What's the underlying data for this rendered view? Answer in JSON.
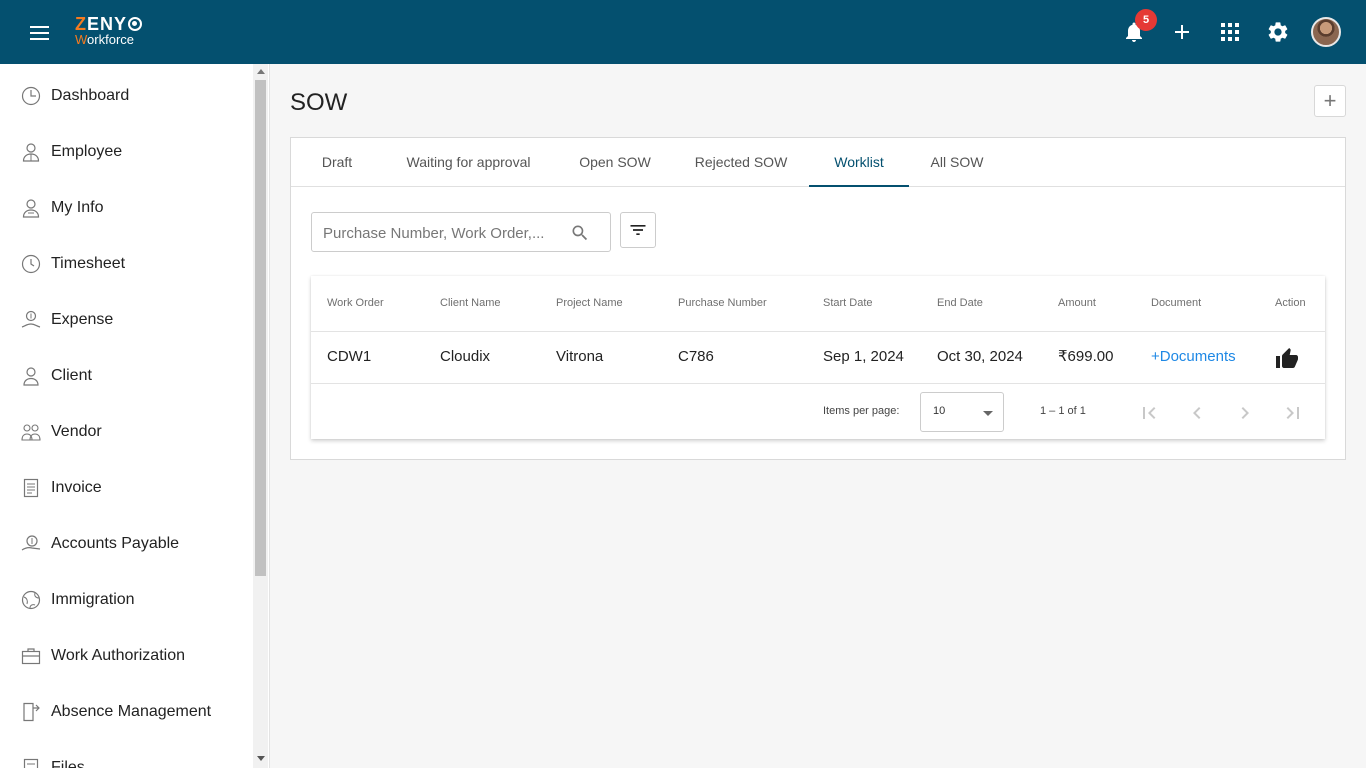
{
  "header": {
    "logo_top": "ZENY",
    "logo_bottom": "Workforce",
    "notification_count": "5",
    "brand_color": "#04506f",
    "accent_color": "#f47b20",
    "icons": [
      "menu-icon",
      "bell-icon",
      "plus-icon",
      "apps-grid-icon",
      "gear-icon",
      "avatar"
    ]
  },
  "sidebar": {
    "items": [
      {
        "label": "Dashboard",
        "icon": "dashboard-icon"
      },
      {
        "label": "Employee",
        "icon": "employee-icon"
      },
      {
        "label": "My Info",
        "icon": "my-info-icon"
      },
      {
        "label": "Timesheet",
        "icon": "clock-icon"
      },
      {
        "label": "Expense",
        "icon": "expense-icon"
      },
      {
        "label": "Client",
        "icon": "client-icon"
      },
      {
        "label": "Vendor",
        "icon": "vendor-icon"
      },
      {
        "label": "Invoice",
        "icon": "invoice-icon"
      },
      {
        "label": "Accounts Payable",
        "icon": "accounts-payable-icon"
      },
      {
        "label": "Immigration",
        "icon": "globe-icon"
      },
      {
        "label": "Work Authorization",
        "icon": "briefcase-icon"
      },
      {
        "label": "Absence Management",
        "icon": "door-icon"
      },
      {
        "label": "Files",
        "icon": "files-icon"
      }
    ]
  },
  "main": {
    "title": "SOW",
    "tabs": [
      "Draft",
      "Waiting for approval",
      "Open SOW",
      "Rejected SOW",
      "Worklist",
      "All SOW"
    ],
    "active_tab": "Worklist",
    "search": {
      "placeholder": "Purchase Number, Work Order,..."
    },
    "table": {
      "columns": [
        "Work Order",
        "Client Name",
        "Project Name",
        "Purchase Number",
        "Start Date",
        "End Date",
        "Amount",
        "Document",
        "Action"
      ],
      "rows": [
        {
          "work_order": "CDW1",
          "client_name": "Cloudix",
          "project_name": "Vitrona",
          "purchase_number": "C786",
          "start_date": "Sep 1, 2024",
          "end_date": "Oct 30, 2024",
          "amount": "₹699.00",
          "document": "+Documents",
          "action_icon": "thumbs-up-icon"
        }
      ]
    },
    "pagination": {
      "items_per_page_label": "Items per page:",
      "items_per_page": "10",
      "range": "1 – 1 of 1"
    }
  }
}
